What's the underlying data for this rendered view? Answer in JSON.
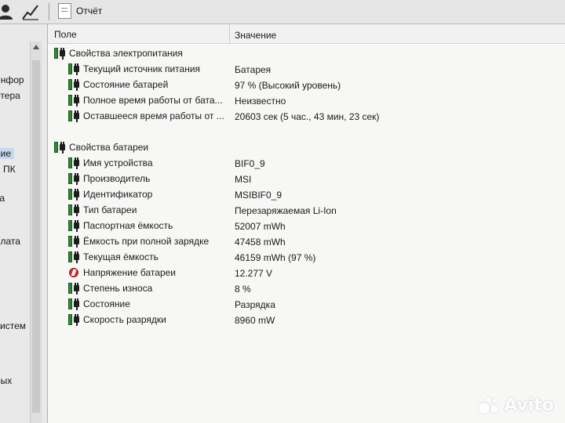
{
  "toolbar": {
    "report_label": "Отчёт"
  },
  "sidebar": {
    "items": [
      {
        "label": "инфор",
        "selected": false
      },
      {
        "label": "отера",
        "selected": false
      },
      {
        "label": "ние",
        "selected": true
      },
      {
        "label": "й ПК",
        "selected": false
      },
      {
        "label": "та",
        "selected": false
      },
      {
        "label": "плата",
        "selected": false
      },
      {
        "label": "систем",
        "selected": false
      },
      {
        "label": "ных",
        "selected": false
      }
    ]
  },
  "list": {
    "header": {
      "field": "Поле",
      "value": "Значение"
    },
    "rows": [
      {
        "name": "Свойства электропитания",
        "value": "",
        "icon": "battery-plug-icon",
        "indent": 0
      },
      {
        "name": "Текущий источник питания",
        "value": "Батарея",
        "icon": "battery-plug-icon",
        "indent": 1
      },
      {
        "name": "Состояние батарей",
        "value": "97 % (Высокий уровень)",
        "icon": "battery-plug-icon",
        "indent": 1
      },
      {
        "name": "Полное время работы от бата...",
        "value": "Неизвестно",
        "icon": "battery-plug-icon",
        "indent": 1
      },
      {
        "name": "Оставшееся время работы от ...",
        "value": "20603 сек (5 час., 43 мин, 23 сек)",
        "icon": "battery-plug-icon",
        "indent": 1
      },
      {
        "name": "Свойства батареи",
        "value": "",
        "icon": "battery-plug-icon",
        "indent": 0
      },
      {
        "name": "Имя устройства",
        "value": "BIF0_9",
        "icon": "battery-plug-icon",
        "indent": 1
      },
      {
        "name": "Производитель",
        "value": "MSI",
        "icon": "battery-plug-icon",
        "indent": 1
      },
      {
        "name": "Идентификатор",
        "value": "MSIBIF0_9",
        "icon": "battery-plug-icon",
        "indent": 1
      },
      {
        "name": "Тип батареи",
        "value": "Перезаряжаемая Li-Ion",
        "icon": "battery-plug-icon",
        "indent": 1
      },
      {
        "name": "Паспортная ёмкость",
        "value": "52007 mWh",
        "icon": "battery-plug-icon",
        "indent": 1
      },
      {
        "name": "Ёмкость при полной зарядке",
        "value": "47458 mWh",
        "icon": "battery-plug-icon",
        "indent": 1
      },
      {
        "name": "Текущая ёмкость",
        "value": "46159 mWh  (97 %)",
        "icon": "battery-plug-icon",
        "indent": 1
      },
      {
        "name": "Напряжение батареи",
        "value": "12.277 V",
        "icon": "voltage-icon",
        "indent": 1
      },
      {
        "name": "Степень износа",
        "value": "8 %",
        "icon": "battery-plug-icon",
        "indent": 1
      },
      {
        "name": "Состояние",
        "value": "Разрядка",
        "icon": "battery-plug-icon",
        "indent": 1
      },
      {
        "name": "Скорость разрядки",
        "value": "8960 mW",
        "icon": "battery-plug-icon",
        "indent": 1
      }
    ]
  },
  "watermark": {
    "text": "Avito"
  }
}
